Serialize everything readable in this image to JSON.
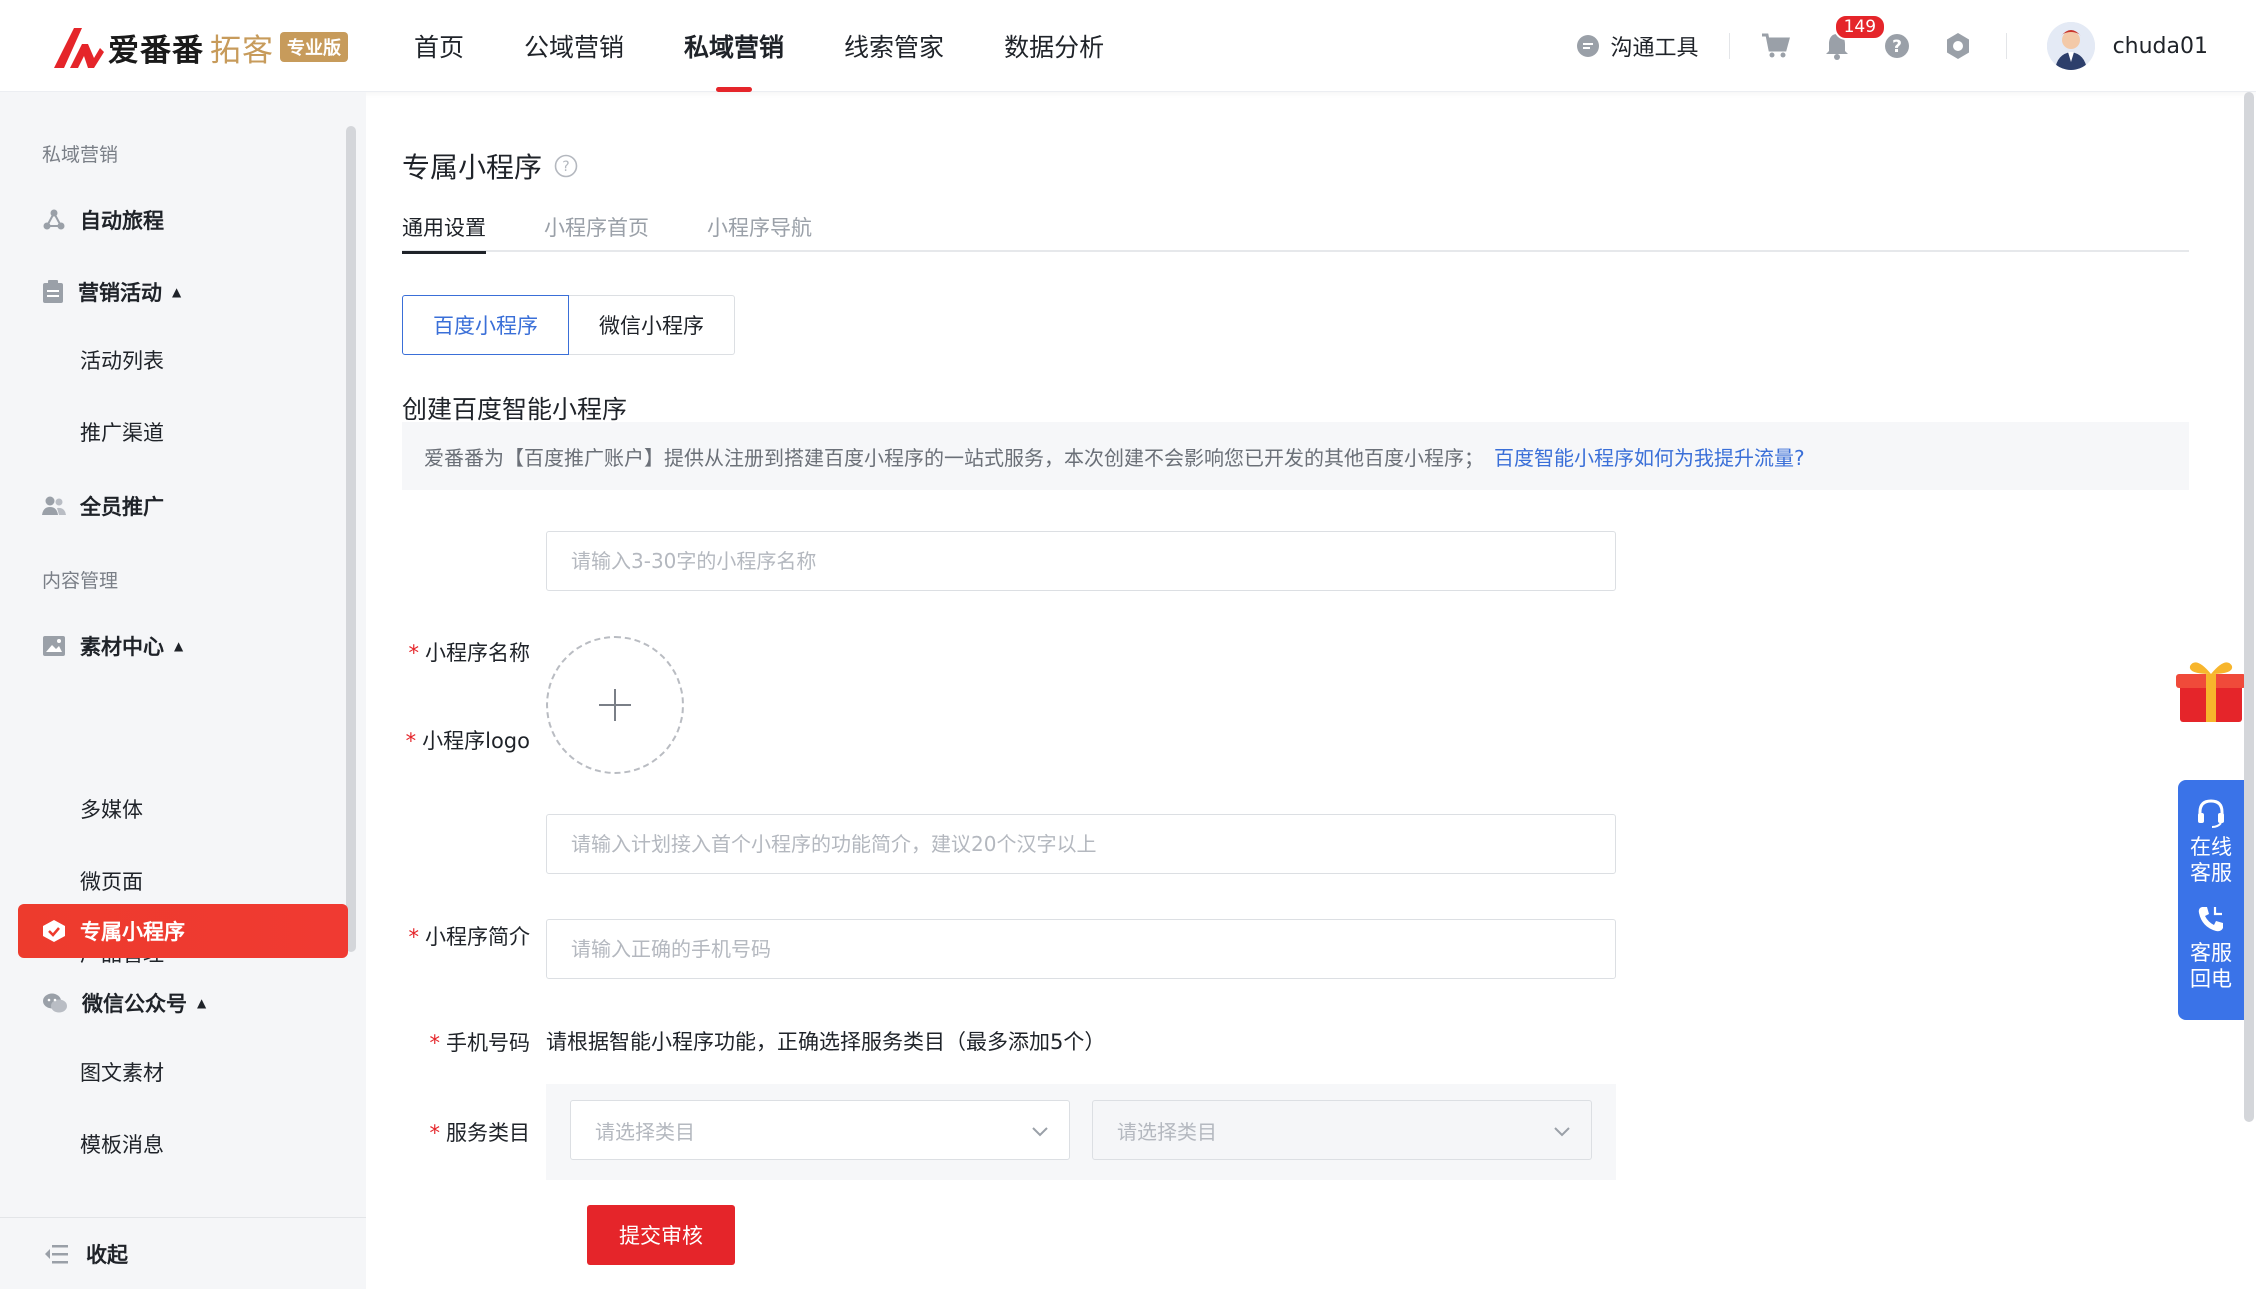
{
  "brand": {
    "name": "爱番番",
    "sub": "拓客",
    "badge": "专业版"
  },
  "nav": {
    "items": [
      {
        "label": "首页"
      },
      {
        "label": "公域营销"
      },
      {
        "label": "私域营销"
      },
      {
        "label": "线索管家"
      },
      {
        "label": "数据分析"
      }
    ]
  },
  "header": {
    "tool_label": "沟通工具",
    "notification_count": "149",
    "username": "chuda01"
  },
  "sidebar": {
    "group1": "私域营销",
    "auto_journey": "自动旅程",
    "marketing_activity": "营销活动",
    "activity_list": "活动列表",
    "promo_channel": "推广渠道",
    "all_staff": "全员推广",
    "group2": "内容管理",
    "material_center": "素材中心",
    "multimedia": "多媒体",
    "micro_page": "微页面",
    "product_mgmt": "产品管理",
    "mini_program": "专属小程序",
    "wechat_official": "微信公众号",
    "article_material": "图文素材",
    "template_msg": "模板消息",
    "collapse": "收起"
  },
  "main": {
    "title": "专属小程序",
    "tabs": [
      "通用设置",
      "小程序首页",
      "小程序导航"
    ],
    "segments": [
      "百度小程序",
      "微信小程序"
    ],
    "section_title": "创建百度智能小程序",
    "notice_text": "爱番番为【百度推广账户】提供从注册到搭建百度小程序的一站式服务，本次创建不会影响您已开发的其他百度小程序；",
    "notice_link": "百度智能小程序如何为我提升流量?",
    "form": {
      "name_label": "小程序名称",
      "name_placeholder": "请输入3-30字的小程序名称",
      "logo_label": "小程序logo",
      "intro_label": "小程序简介",
      "intro_placeholder": "请输入计划接入首个小程序的功能简介，建议20个汉字以上",
      "phone_label": "手机号码",
      "phone_placeholder": "请输入正确的手机号码",
      "category_label": "服务类目",
      "category_hint": "请根据智能小程序功能，正确选择服务类目（最多添加5个）",
      "category_placeholder_1": "请选择类目",
      "category_placeholder_2": "请选择类目",
      "submit": "提交审核"
    }
  },
  "float": {
    "online_service": "在线\n客服",
    "callback": "客服\n回电"
  },
  "colors": {
    "brand_red": "#e5252a",
    "link_blue": "#3a6fd8",
    "gold": "#c79b5b",
    "service_blue": "#3a73e8"
  }
}
